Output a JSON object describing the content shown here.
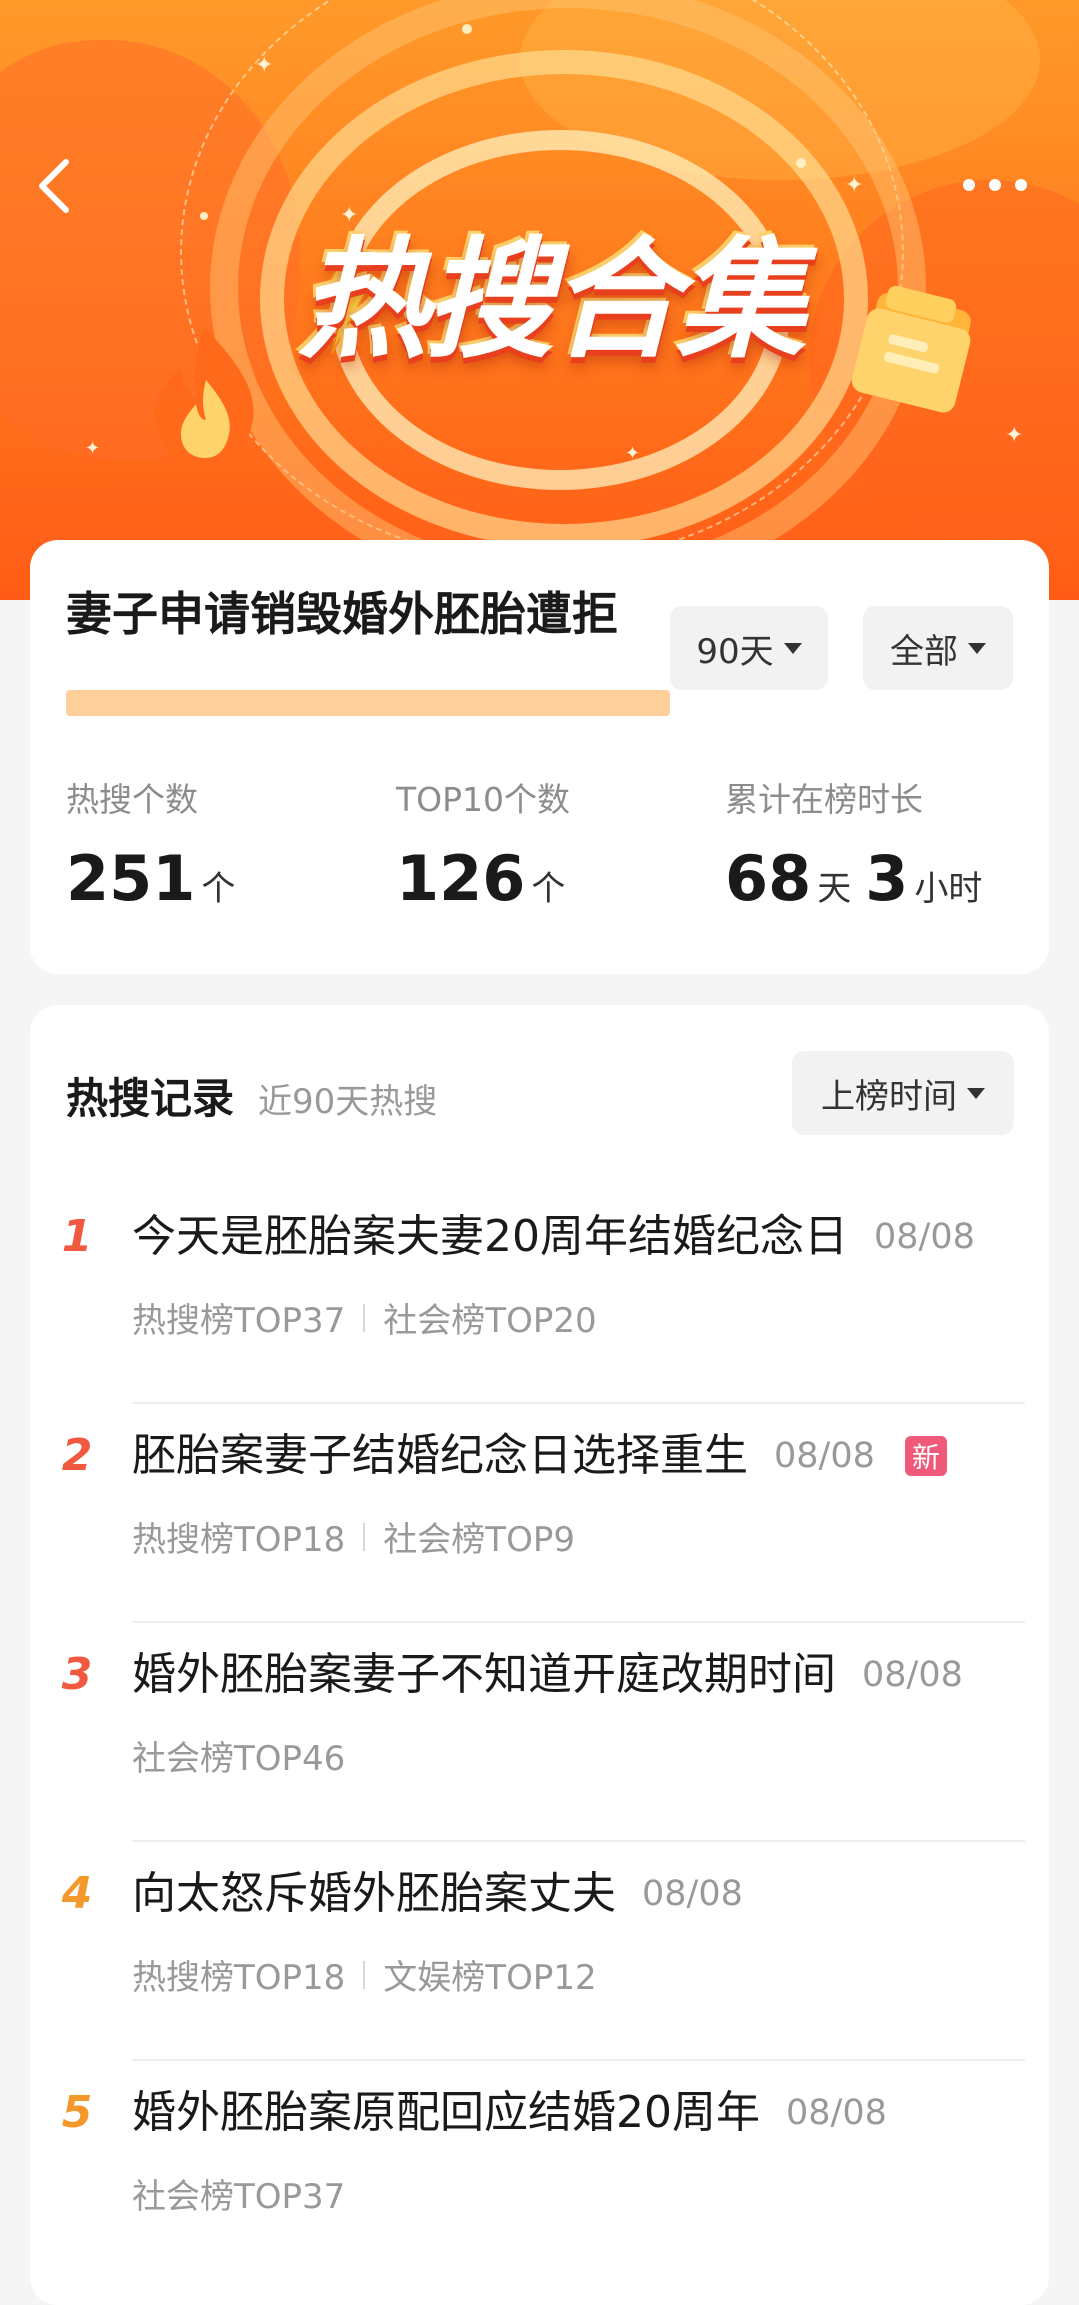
{
  "banner": {
    "title": "热搜合集"
  },
  "topic": {
    "title": "妻子申请销毁婚外胚胎遭拒",
    "filter_days": "90天",
    "filter_scope": "全部"
  },
  "stats": [
    {
      "label": "热搜个数",
      "value": "251",
      "unit": "个"
    },
    {
      "label": "TOP10个数",
      "value": "126",
      "unit": "个"
    },
    {
      "label": "累计在榜时长",
      "value": "68",
      "unit": "天",
      "value2": "3",
      "unit2": "小时"
    }
  ],
  "records": {
    "title": "热搜记录",
    "subtitle": "近90天热搜",
    "sort_label": "上榜时间",
    "items": [
      {
        "rank": "1",
        "title": "今天是胚胎案夫妻20周年结婚纪念日",
        "date": "08/08",
        "tags": [
          "热搜榜TOP37",
          "社会榜TOP20"
        ],
        "badge": ""
      },
      {
        "rank": "2",
        "title": "胚胎案妻子结婚纪念日选择重生",
        "date": "08/08",
        "tags": [
          "热搜榜TOP18",
          "社会榜TOP9"
        ],
        "badge": "新"
      },
      {
        "rank": "3",
        "title": "婚外胚胎案妻子不知道开庭改期时间",
        "date": "08/08",
        "tags": [
          "社会榜TOP46"
        ],
        "badge": ""
      },
      {
        "rank": "4",
        "title": "向太怒斥婚外胚胎案丈夫",
        "date": "08/08",
        "tags": [
          "热搜榜TOP18",
          "文娱榜TOP12"
        ],
        "badge": ""
      },
      {
        "rank": "5",
        "title": "婚外胚胎案原配回应结婚20周年",
        "date": "08/08",
        "tags": [
          "社会榜TOP37"
        ],
        "badge": ""
      }
    ]
  },
  "colors": {
    "banner_top": "#ff9a2a",
    "banner_bottom": "#ff5b16",
    "rank_hot": "#f0593f",
    "rank_warm": "#f5982b",
    "new_badge": "#f05a7a",
    "title_highlight": "#ffcf9c"
  },
  "icons": [
    "back-arrow-icon",
    "more-dots-icon",
    "lightning-bolt-icon",
    "flame-icon",
    "folder-icon",
    "caret-down-icon"
  ]
}
